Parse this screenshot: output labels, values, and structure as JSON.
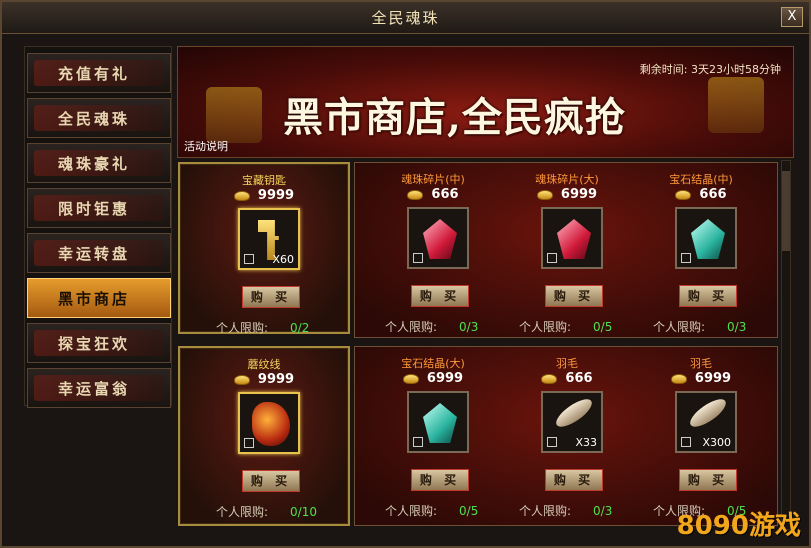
{
  "window": {
    "title": "全民魂珠",
    "close_label": "X"
  },
  "sidebar": {
    "items": [
      {
        "label": "充值有礼",
        "active": false
      },
      {
        "label": "全民魂珠",
        "active": false
      },
      {
        "label": "魂珠豪礼",
        "active": false
      },
      {
        "label": "限时钜惠",
        "active": false
      },
      {
        "label": "幸运转盘",
        "active": false
      },
      {
        "label": "黑市商店",
        "active": true
      },
      {
        "label": "探宝狂欢",
        "active": false
      },
      {
        "label": "幸运富翁",
        "active": false
      }
    ]
  },
  "banner": {
    "title": "黑市商店,全民疯抢",
    "time_remaining": "剩余时间: 3天23小时58分钟",
    "help_link": "活动说明"
  },
  "shop": {
    "buy_label": "购 买",
    "limit_label": "个人限购:",
    "rows": [
      {
        "featured": {
          "name": "宝藏钥匙",
          "price": "9999",
          "qty": "X60",
          "limit": "0/2",
          "icon": "golden-key"
        },
        "items": [
          {
            "name": "魂珠碎片(中)",
            "price": "666",
            "qty": "",
            "limit": "0/3",
            "icon": "red-crystal"
          },
          {
            "name": "魂珠碎片(大)",
            "price": "6999",
            "qty": "",
            "limit": "0/5",
            "icon": "red-crystal"
          },
          {
            "name": "宝石结晶(中)",
            "price": "666",
            "qty": "",
            "limit": "0/3",
            "icon": "cyan-crystal"
          }
        ]
      },
      {
        "featured": {
          "name": "蘑纹线",
          "price": "9999",
          "qty": "",
          "limit": "0/10",
          "icon": "dragon-ornament"
        },
        "items": [
          {
            "name": "宝石结晶(大)",
            "price": "6999",
            "qty": "",
            "limit": "0/5",
            "icon": "cyan-crystal"
          },
          {
            "name": "羽毛",
            "price": "666",
            "qty": "X33",
            "limit": "0/3",
            "icon": "feather"
          },
          {
            "name": "羽毛",
            "price": "6999",
            "qty": "X300",
            "limit": "0/5",
            "icon": "feather"
          }
        ]
      }
    ]
  },
  "watermark": "8090游戏"
}
